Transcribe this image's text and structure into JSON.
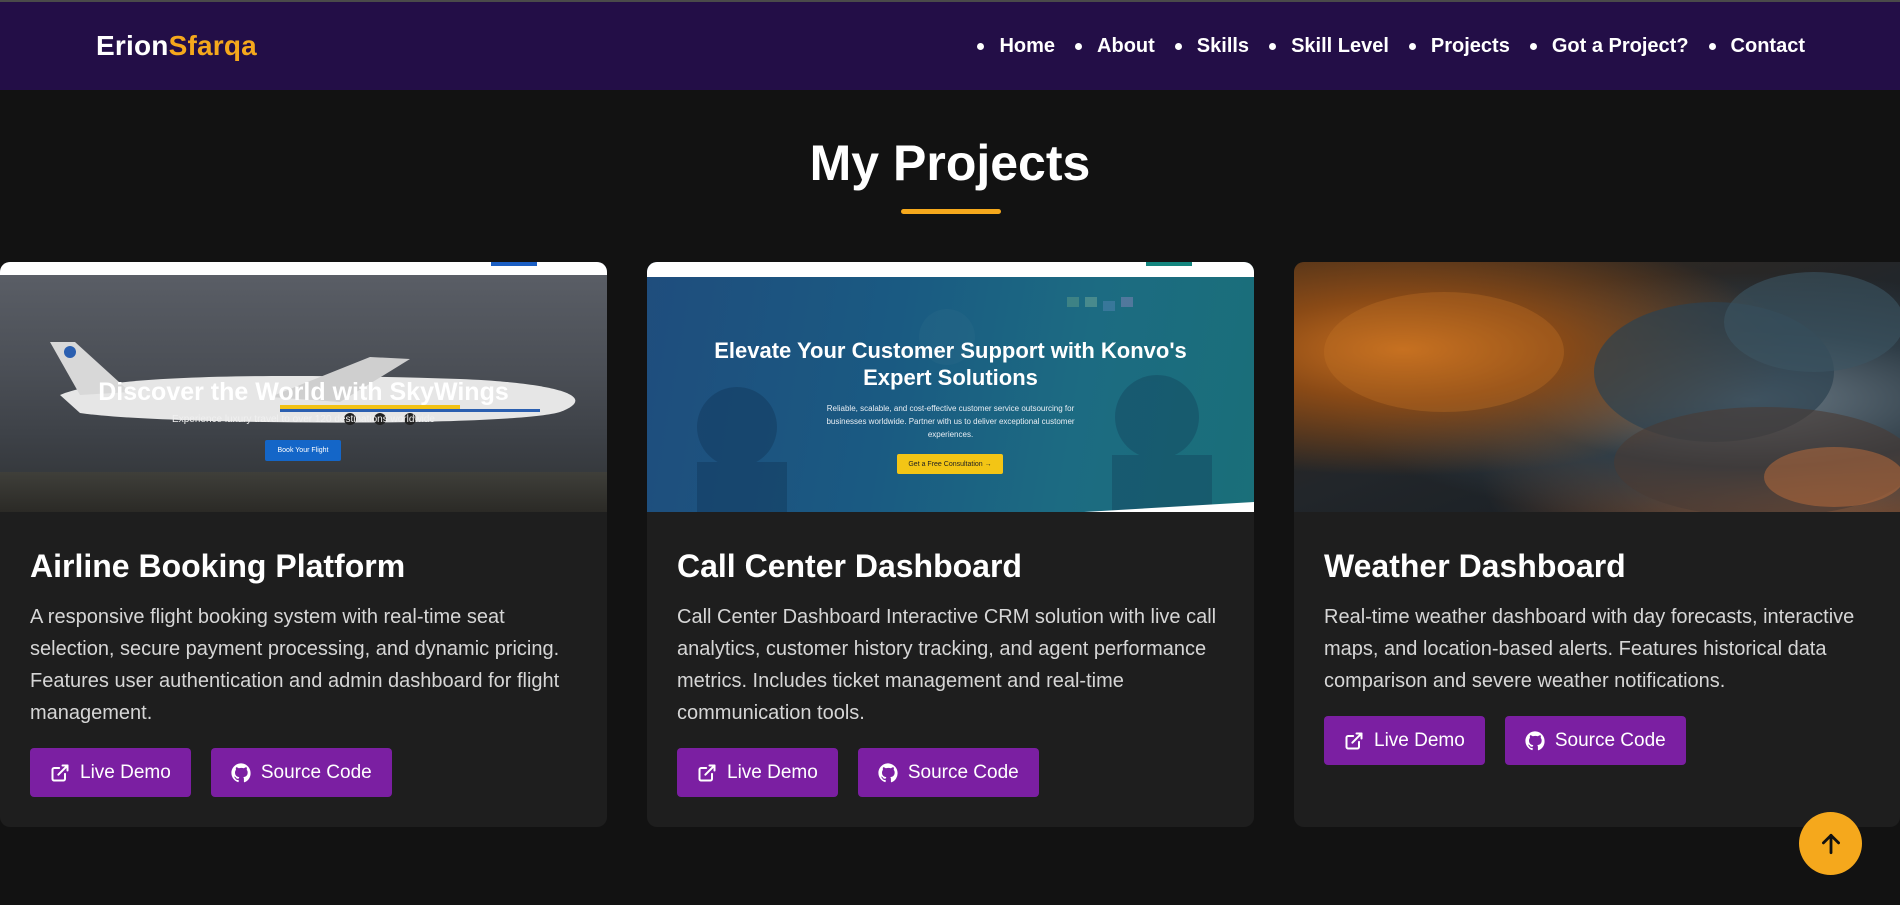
{
  "brand": {
    "first": "Erion",
    "last": "Sfarqa"
  },
  "nav": {
    "items": [
      "Home",
      "About",
      "Skills",
      "Skill Level",
      "Projects",
      "Got a Project?",
      "Contact"
    ]
  },
  "section": {
    "title": "My Projects"
  },
  "projects": [
    {
      "title": "Airline Booking Platform",
      "description": "A responsive flight booking system with real-time seat selection, secure payment processing, and dynamic pricing. Features user authentication and admin dashboard for flight management.",
      "live_label": "Live Demo",
      "source_label": "Source Code",
      "thumb": {
        "hero_title": "Discover the World with SkyWings",
        "hero_sub": "Experience luxury travel to over 120 destinations worldwide",
        "hero_button": "Book Your Flight"
      }
    },
    {
      "title": "Call Center Dashboard",
      "description": "Call Center Dashboard Interactive CRM solution with live call analytics, customer history tracking, and agent performance metrics. Includes ticket management and real-time communication tools.",
      "live_label": "Live Demo",
      "source_label": "Source Code",
      "thumb": {
        "hero_title": "Elevate Your Customer Support with Konvo's Expert Solutions",
        "hero_sub": "Reliable, scalable, and cost-effective customer service outsourcing for businesses worldwide. Partner with us to deliver exceptional customer experiences.",
        "hero_button": "Get a Free Consultation →"
      }
    },
    {
      "title": "Weather Dashboard",
      "description": "Real-time weather dashboard with day forecasts, interactive maps, and location-based alerts. Features historical data comparison and severe weather notifications.",
      "live_label": "Live Demo",
      "source_label": "Source Code"
    }
  ],
  "colors": {
    "nav_bg": "#230e47",
    "accent": "#f5a81c",
    "button": "#7b1fa2",
    "card_bg": "#1e1e1e",
    "page_bg": "#121212"
  },
  "icons": {
    "live": "external-link-icon",
    "source": "github-icon",
    "scroll_top": "arrow-up-icon"
  }
}
